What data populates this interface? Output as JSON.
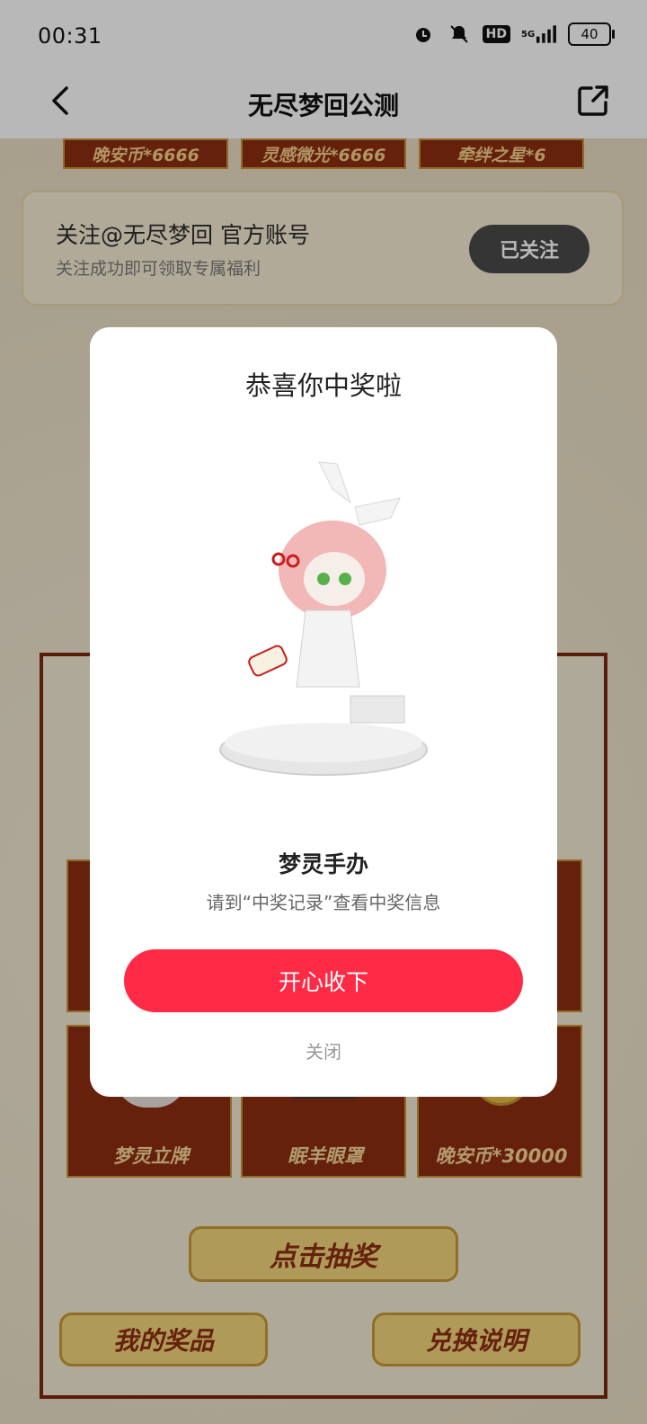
{
  "status_bar": {
    "time": "00:31",
    "hd_label": "HD",
    "network": "5G",
    "battery": "40"
  },
  "nav": {
    "title": "无尽梦回公测"
  },
  "top_rewards": [
    "晚安币*6666",
    "灵感微光*6666",
    "牵绊之星*6"
  ],
  "follow_card": {
    "title": "关注@无尽梦回 官方账号",
    "subtitle": "关注成功即可领取专属福利",
    "button": "已关注"
  },
  "prize_grid_bottom": [
    "梦灵立牌",
    "眠羊眼罩",
    "晚安币*30000"
  ],
  "actions": {
    "draw": "点击抽奖",
    "my_prizes": "我的奖品",
    "redeem_info": "兑换说明"
  },
  "modal": {
    "title": "恭喜你中奖啦",
    "prize_name": "梦灵手办",
    "hint": "请到“中奖记录”查看中奖信息",
    "accept_button": "开心收下",
    "close_link": "关闭"
  },
  "colors": {
    "accept_red": "#ff2a45",
    "chip_brown": "#8c2e10",
    "gold": "#f3d67d"
  }
}
